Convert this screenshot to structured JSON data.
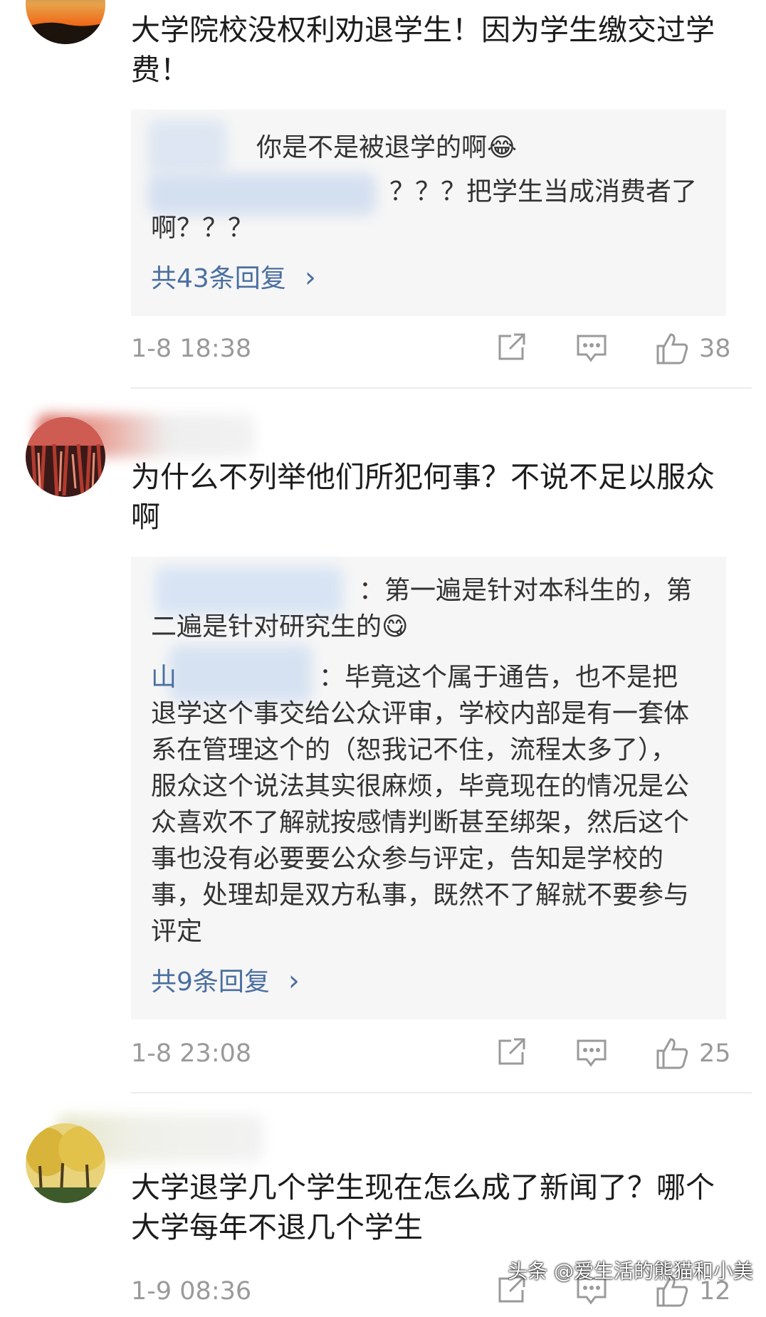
{
  "comments": [
    {
      "text": "大学院校没权利劝退学生！因为学生缴交过学费！",
      "replies": [
        {
          "text": "你是不是被退学的啊😂"
        },
        {
          "text": "？？？把学生当成消费者了啊？？？"
        }
      ],
      "more_replies": "共43条回复",
      "time": "1-8  18:38",
      "likes": "38"
    },
    {
      "text": "为什么不列举他们所犯何事？不说不足以服众啊",
      "replies": [
        {
          "text": "：第一遍是针对本科生的，第二遍是针对研究生的😋"
        },
        {
          "name_fragment": "山",
          "text": "：毕竟这个属于通告，也不是把退学这个事交给公众评审，学校内部是有一套体系在管理这个的（恕我记不住，流程太多了），服众这个说法其实很麻烦，毕竟现在的情况是公众喜欢不了解就按感情判断甚至绑架，然后这个事也没有必要要公众参与评定，告知是学校的事，处理却是双方私事，既然不了解就不要参与评定"
        }
      ],
      "more_replies": "共9条回复",
      "time": "1-8  23:08",
      "likes": "25"
    },
    {
      "text": "大学退学几个学生现在怎么成了新闻了？哪个大学每年不退几个学生",
      "time": "1-9  08:36",
      "likes": "12"
    }
  ],
  "chevron": "›",
  "watermark": "头条 @爱生活的熊猫和小美",
  "icons": [
    "share-icon",
    "comment-icon",
    "like-icon"
  ],
  "colors": {
    "link": "#4a6fa0",
    "meta": "#9a9a9a",
    "reply_bg": "#f6f6f6"
  }
}
